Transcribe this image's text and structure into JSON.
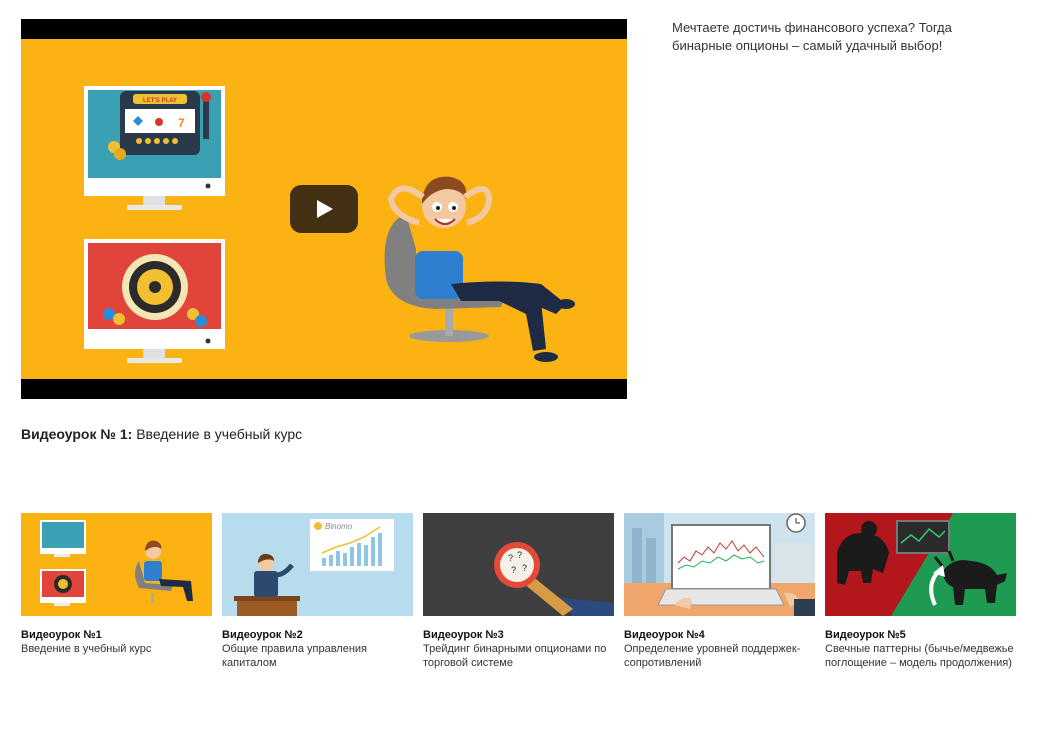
{
  "video": {
    "play_icon": "play-icon",
    "slot_screen_label": "LET'S PLAY"
  },
  "intro_text": "Мечтаете достичь финансового успеха? Тогда бинарные опционы – самый удачный выбор!",
  "caption": {
    "bold": "Видеоурок № 1:",
    "text": " Введение в учебный курс"
  },
  "lessons": [
    {
      "title": "Видеоурок №1",
      "desc": "Введение в учебный курс"
    },
    {
      "title": "Видеоурок №2",
      "desc": "Общие правила управления капиталом",
      "brand": "Binomo"
    },
    {
      "title": "Видеоурок №3",
      "desc": "Трейдинг бинарными опционами по торговой системе"
    },
    {
      "title": "Видеоурок №4",
      "desc": "Определение уровней поддержек-сопротивлений"
    },
    {
      "title": "Видеоурок №5",
      "desc": "Свечные паттерны (бычье/медвежье поглощение – модель продолжения)"
    }
  ],
  "colors": {
    "video_bg": "#fbb313",
    "thumb2_bg": "#b7dced",
    "thumb3_bg": "#3e3e40",
    "thumb5_red": "#b3161b",
    "thumb5_green": "#1e9a52"
  }
}
